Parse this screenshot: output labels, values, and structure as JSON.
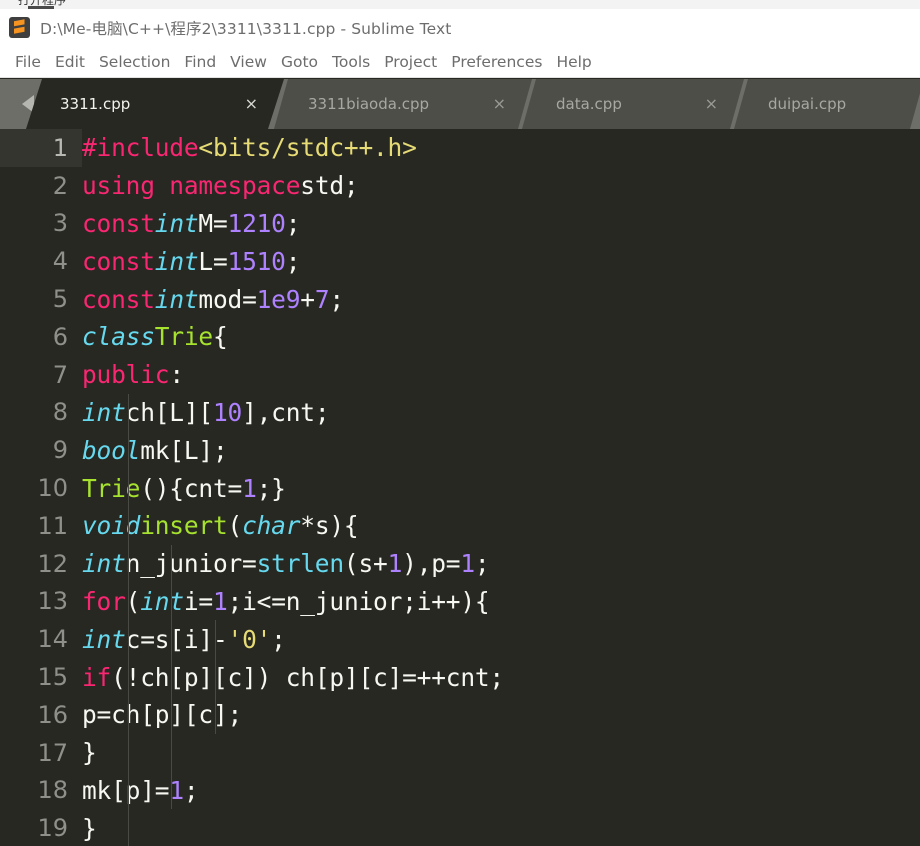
{
  "sliver": {
    "text": "打开程序",
    "name": "background-window-sliver"
  },
  "titlebar": {
    "icon_name": "sublime-text-logo",
    "title": "D:\\Me-电脑\\C++\\程序2\\3311\\3311.cpp - Sublime Text"
  },
  "menubar": {
    "items": [
      {
        "label": "File"
      },
      {
        "label": "Edit"
      },
      {
        "label": "Selection"
      },
      {
        "label": "Find"
      },
      {
        "label": "View"
      },
      {
        "label": "Goto"
      },
      {
        "label": "Tools"
      },
      {
        "label": "Project"
      },
      {
        "label": "Preferences"
      },
      {
        "label": "Help"
      }
    ]
  },
  "tabbar": {
    "nav_prev_icon": "caret-left-icon",
    "nav_next_icon": "caret-right-icon",
    "close_glyph": "×",
    "tabs": [
      {
        "label": "3311.cpp",
        "active": true,
        "has_close": true
      },
      {
        "label": "3311biaoda.cpp",
        "active": false,
        "has_close": true
      },
      {
        "label": "data.cpp",
        "active": false,
        "has_close": true
      },
      {
        "label": "duipai.cpp",
        "active": false,
        "has_close": false
      }
    ]
  },
  "editor": {
    "theme": {
      "background": "#272822",
      "foreground": "#f8f8f2",
      "gutter_text": "#8f908a",
      "current_line_gutter": "#34352e",
      "keyword": "#f92672",
      "type": "#66d9ef",
      "function": "#a6e22e",
      "number": "#ae81ff",
      "string": "#e6db74",
      "indent_guide": "#494a43"
    },
    "current_line": 1,
    "lines": [
      {
        "n": "1",
        "indent": 0,
        "text": "#include <bits/stdc++.h>"
      },
      {
        "n": "2",
        "indent": 0,
        "text": "using namespace std;"
      },
      {
        "n": "3",
        "indent": 0,
        "text": "const int M=1210;"
      },
      {
        "n": "4",
        "indent": 0,
        "text": "const int L=1510;"
      },
      {
        "n": "5",
        "indent": 0,
        "text": "const int mod=1e9+7;"
      },
      {
        "n": "6",
        "indent": 0,
        "text": "class Trie{"
      },
      {
        "n": "7",
        "indent": 0,
        "text": "public:"
      },
      {
        "n": "8",
        "indent": 1,
        "text": "    int ch[L][10],cnt;"
      },
      {
        "n": "9",
        "indent": 1,
        "text": "    bool mk[L];"
      },
      {
        "n": "10",
        "indent": 1,
        "text": "    Trie(){cnt=1;}"
      },
      {
        "n": "11",
        "indent": 1,
        "text": "    void insert(char*s){"
      },
      {
        "n": "12",
        "indent": 2,
        "text": "        int n_junior=strlen(s+1),p=1;"
      },
      {
        "n": "13",
        "indent": 2,
        "text": "        for(int i=1;i<=n_junior;i++){"
      },
      {
        "n": "14",
        "indent": 3,
        "text": "            int c=s[i]-'0';"
      },
      {
        "n": "15",
        "indent": 3,
        "text": "            if(!ch[p][c]) ch[p][c]=++cnt;"
      },
      {
        "n": "16",
        "indent": 3,
        "text": "            p=ch[p][c];"
      },
      {
        "n": "17",
        "indent": 2,
        "text": "        }"
      },
      {
        "n": "18",
        "indent": 2,
        "text": "        mk[p]=1;"
      },
      {
        "n": "19",
        "indent": 1,
        "text": "    }"
      }
    ]
  }
}
